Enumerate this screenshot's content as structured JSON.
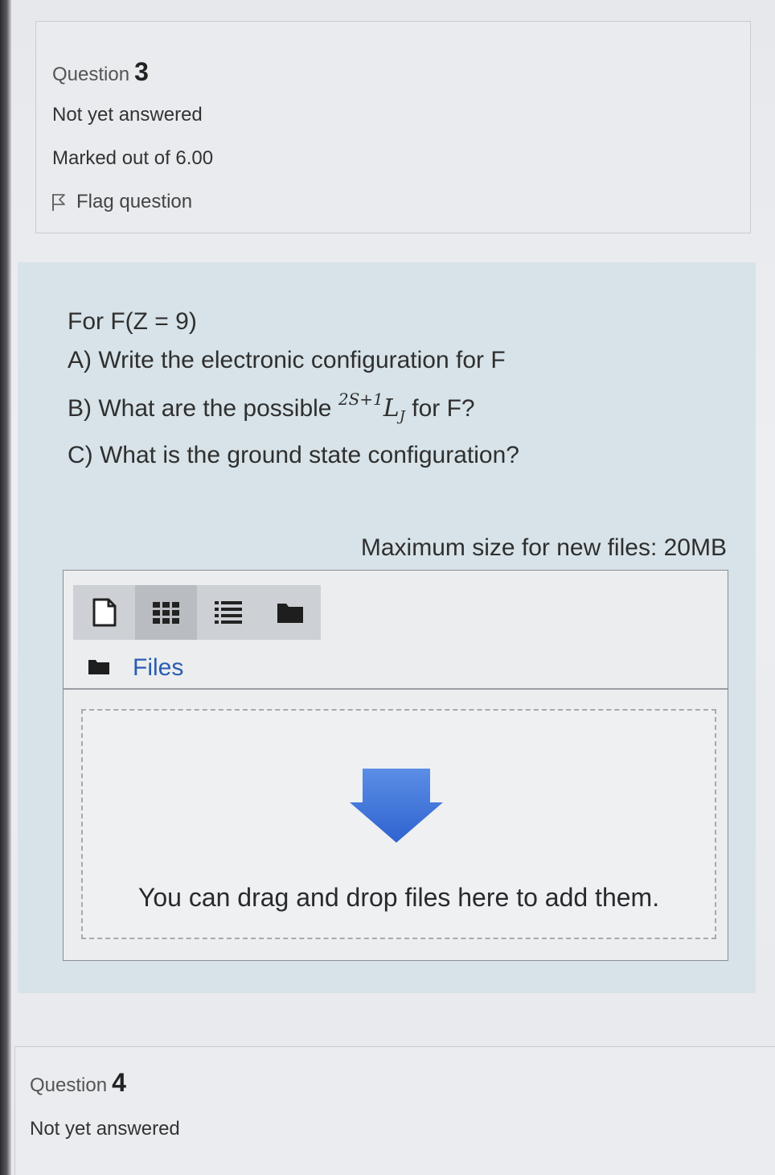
{
  "question3": {
    "label": "Question",
    "number": "3",
    "state": "Not yet answered",
    "grade": "Marked out of 6.00",
    "flag_label": "Flag question"
  },
  "question_text": {
    "line1": "For F(Z = 9)",
    "line2": "A) Write the electronic configuration for F",
    "line3_prefix": "B) What are the possible",
    "term_superscript": "2S+1",
    "term_symbol": "L",
    "term_subscript": "J",
    "line3_suffix": "for F?",
    "line4": "C) What is the ground state configuration?"
  },
  "filemanager": {
    "max_size": "Maximum size for new files: 20MB",
    "toolbar": [
      "add-file-icon",
      "grid-view-icon",
      "list-view-icon",
      "folder-view-icon"
    ],
    "path_label": "Files",
    "drop_text": "You can drag and drop files here to add them."
  },
  "question4": {
    "label": "Question",
    "number": "4",
    "state": "Not yet answered"
  },
  "colors": {
    "link": "#2a5db0",
    "arrow": "#3f72d8",
    "content_bg": "#d7e3e8"
  }
}
